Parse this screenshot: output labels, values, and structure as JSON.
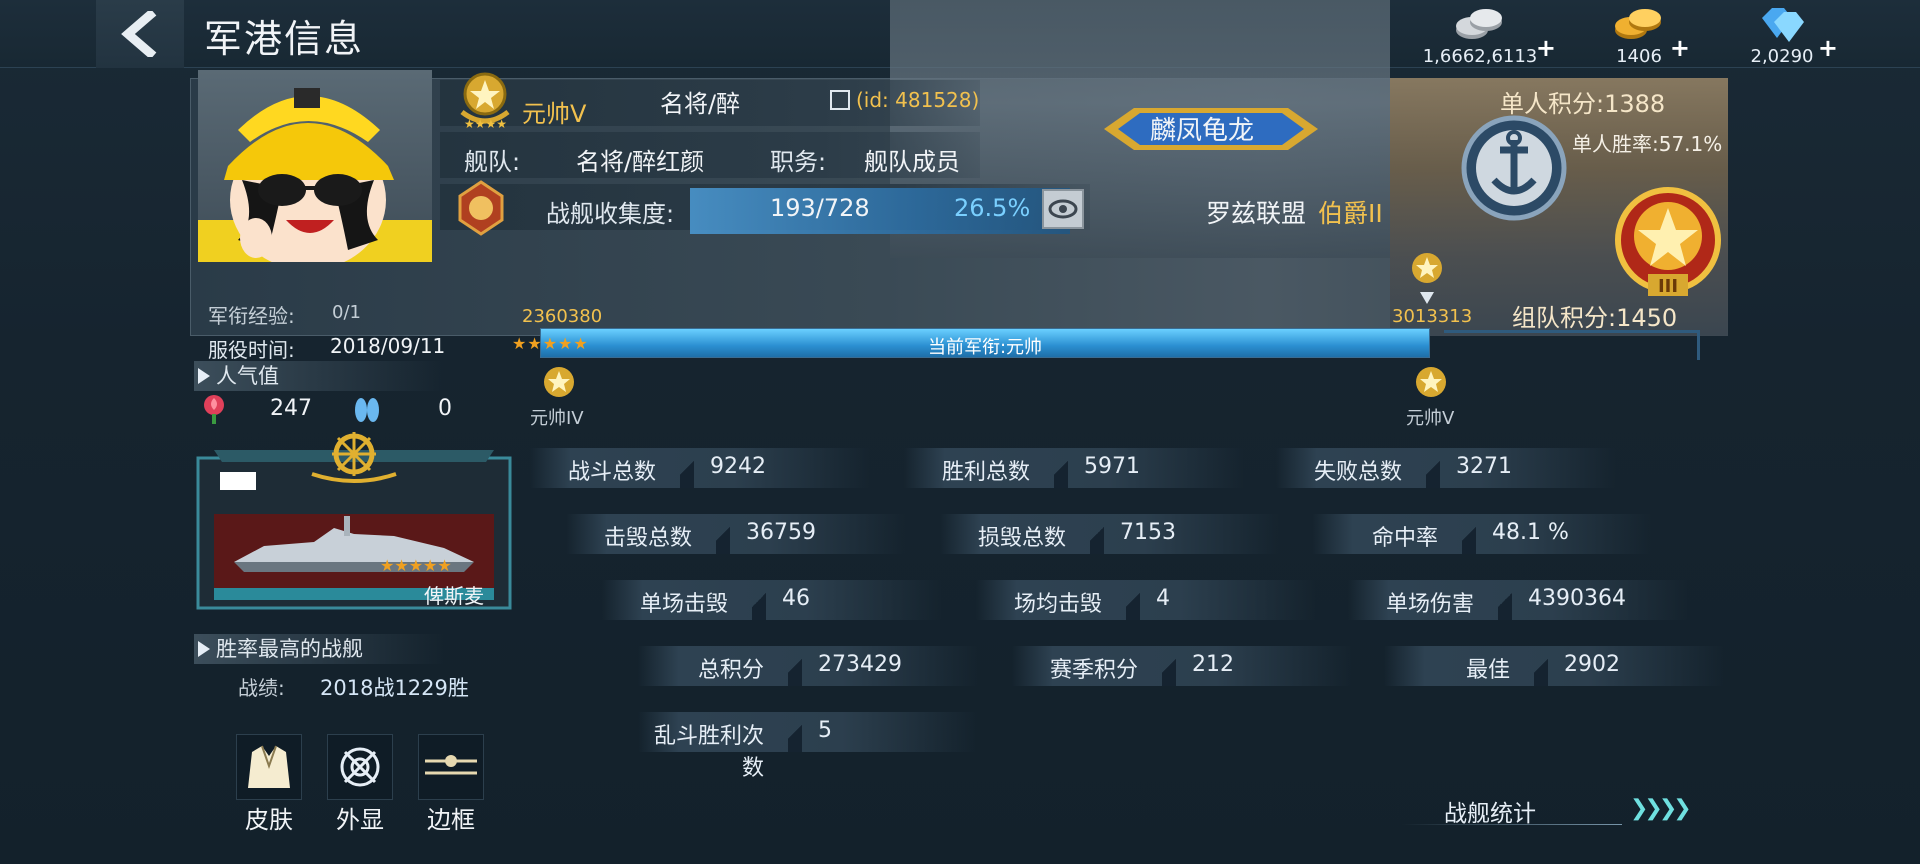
{
  "header": {
    "title": "军港信息"
  },
  "currencies": [
    {
      "name": "silver-coins",
      "value": "1,6662,6113",
      "color": "#c8ccd0"
    },
    {
      "name": "gold-coins",
      "value": "1406",
      "color": "#f0b030"
    },
    {
      "name": "diamonds",
      "value": "2,0290",
      "color": "#6ec8ff"
    }
  ],
  "profile": {
    "rank": "元帅V",
    "player_name": "名将/醉",
    "id": "(id: 481528)",
    "fleet_label": "舰队:",
    "fleet_name": "名将/醉红颜",
    "duty_label": "职务:",
    "duty": "舰队成员",
    "collection_label": "战舰收集度:",
    "collection": "193/728",
    "collection_pct": "26.5%",
    "fleet_badge": "麟凤龟龙",
    "alliance": "罗兹联盟",
    "alliance_title": "伯爵II"
  },
  "scores": {
    "solo": "单人积分:1388",
    "solo_rate": "单人胜率:57.1%",
    "team": "组队积分:1450"
  },
  "progress": {
    "exp_label": "军衔经验:",
    "exp": "0/1",
    "service_label": "服役时间:",
    "service_date": "2018/09/11",
    "left_points": "2360380",
    "right_points": "3013313",
    "bar_text": "当前军衔:元帅",
    "fill_fraction": 1.0,
    "left_rank": "元帅IV",
    "right_rank": "元帅V",
    "stars": "★★★★★"
  },
  "popularity": {
    "heading": "人气值",
    "roses": "247",
    "slippers": "0"
  },
  "best_ship": {
    "heading": "胜率最高的战舰",
    "name": "俾斯麦",
    "stars": "★★★★★",
    "record_label": "战绩:",
    "record": "2018战1229胜"
  },
  "bottom_buttons": [
    {
      "label": "皮肤",
      "icon": "suit-icon"
    },
    {
      "label": "外显",
      "icon": "crosshair-icon"
    },
    {
      "label": "边框",
      "icon": "frame-icon"
    }
  ],
  "stats": [
    {
      "k": "战斗总数",
      "v": "9242"
    },
    {
      "k": "胜利总数",
      "v": "5971"
    },
    {
      "k": "失败总数",
      "v": "3271"
    },
    {
      "k": "击毁总数",
      "v": "36759"
    },
    {
      "k": "损毁总数",
      "v": "7153"
    },
    {
      "k": "命中率",
      "v": "48.1 %"
    },
    {
      "k": "单场击毁",
      "v": "46"
    },
    {
      "k": "场均击毁",
      "v": "4"
    },
    {
      "k": "单场伤害",
      "v": "4390364"
    },
    {
      "k": "总积分",
      "v": "273429"
    },
    {
      "k": "赛季积分",
      "v": "212"
    },
    {
      "k": "最佳",
      "v": "2902"
    },
    {
      "k": "乱斗胜利次数",
      "v": "5"
    }
  ],
  "fleet_stats_button": "战舰统计"
}
